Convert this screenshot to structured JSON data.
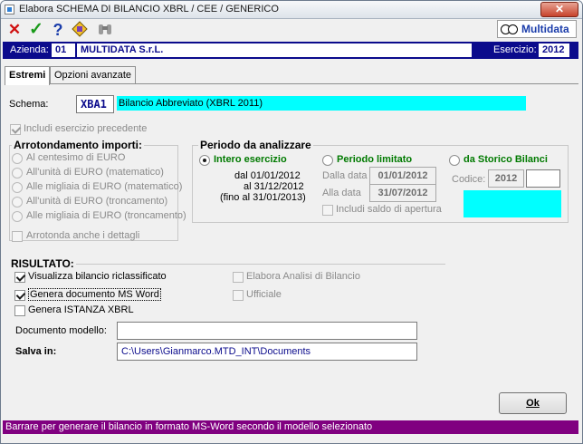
{
  "window": {
    "title": "Elabora SCHEMA DI BILANCIO XBRL / CEE / GENERICO",
    "close_glyph": "✕"
  },
  "toolbar": {
    "cancel_glyph": "✕",
    "confirm_glyph": "✓",
    "help_glyph": "?",
    "logo_text": "Multidata"
  },
  "company": {
    "azienda_label": "Azienda:",
    "azienda_code": "01",
    "azienda_name": "MULTIDATA S.r.L.",
    "esercizio_label": "Esercizio:",
    "esercizio_value": "2012"
  },
  "tabs": [
    {
      "label": "Estremi",
      "active": true
    },
    {
      "label": "Opzioni avanzate",
      "active": false
    }
  ],
  "schema": {
    "label": "Schema:",
    "code": "XBA1",
    "description": "Bilancio Abbreviato (XBRL 2011)",
    "include_prev_label": "Includi esercizio precedente"
  },
  "rounding": {
    "title": "Arrotondamento importi:",
    "options": [
      "Al centesimo di EURO",
      "All'unità di EURO (matematico)",
      "Alle migliaia di EURO (matematico)",
      "All'unità di EURO (troncamento)",
      "Alle migliaia di EURO (troncamento)"
    ],
    "details_label": "Arrotonda anche i dettagli"
  },
  "period": {
    "title": "Periodo da analizzare",
    "intero_label": "Intero esercizio",
    "limitato_label": "Periodo limitato",
    "storico_label": "da Storico Bilanci",
    "range_line1": "dal 01/01/2012",
    "range_line2": "al 31/12/2012",
    "range_line3": "(fino al 31/01/2013)",
    "dalla_label": "Dalla data",
    "dalla_value": "01/01/2012",
    "alla_label": "Alla data",
    "alla_value": "31/07/2012",
    "saldo_label": "Includi saldo di apertura",
    "codice_label": "Codice:",
    "codice_value": "2012",
    "codice_extra": ""
  },
  "result": {
    "title": "RISULTATO:",
    "visualizza_label": "Visualizza bilancio riclassificato",
    "word_label": "Genera documento MS Word",
    "xbrl_label": "Genera ISTANZA XBRL",
    "analisi_label": "Elabora Analisi di Bilancio",
    "ufficiale_label": "Ufficiale",
    "modello_label": "Documento modello:",
    "modello_value": "",
    "salva_label": "Salva in:",
    "salva_value": "C:\\Users\\Gianmarco.MTD_INT\\Documents"
  },
  "ok_label": "Ok",
  "status_text": "Barrare per generare il bilancio in formato MS-Word secondo il modello selezionato",
  "colors": {
    "company_bar": "#0b0b8c",
    "highlight_cyan": "#00ffff",
    "status_bar": "#800080",
    "period_green": "#007a00"
  }
}
